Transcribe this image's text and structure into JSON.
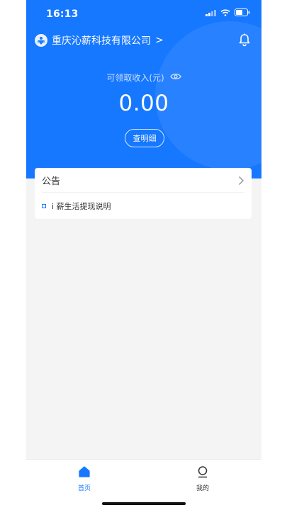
{
  "status_bar": {
    "time": "16:13"
  },
  "header": {
    "company_name": "重庆沁薪科技有限公司",
    "chevron": ">"
  },
  "income": {
    "label": "可领取收入(元)",
    "amount": "0.00",
    "detail_button": "查明细"
  },
  "notice": {
    "title": "公告",
    "items": [
      {
        "text": "i 薪生活提现说明"
      }
    ]
  },
  "tabs": [
    {
      "label": "首页",
      "active": true
    },
    {
      "label": "我的",
      "active": false
    }
  ],
  "colors": {
    "primary": "#1677ff",
    "background": "#f4f4f4"
  }
}
